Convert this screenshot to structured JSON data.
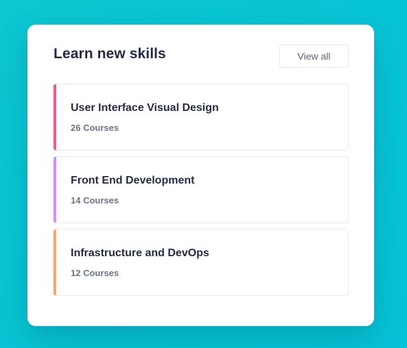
{
  "card": {
    "title": "Learn new skills",
    "view_all_label": "View all"
  },
  "courses": [
    {
      "name": "User Interface Visual Design",
      "count": "26 Courses",
      "accent": "#ec5c93"
    },
    {
      "name": "Front End Development",
      "count": "14 Courses",
      "accent": "#d88df5"
    },
    {
      "name": "Infrastructure and DevOps",
      "count": "12 Courses",
      "accent": "#f8a770"
    }
  ]
}
